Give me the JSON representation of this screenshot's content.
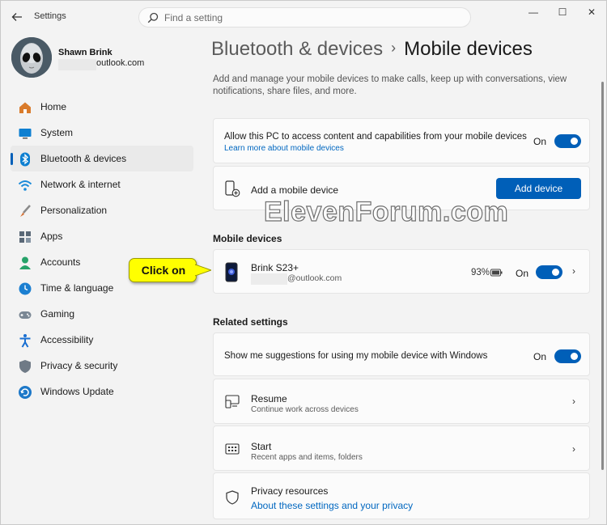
{
  "app": {
    "title": "Settings"
  },
  "search": {
    "placeholder": "Find a setting"
  },
  "window_controls": {
    "minimize": "—",
    "maximize": "☐",
    "close": "✕"
  },
  "profile": {
    "name": "Shawn Brink",
    "email_visible": "outlook.com"
  },
  "nav": {
    "items": [
      {
        "label": "Home",
        "icon": "home-icon",
        "color": "#d97b2b"
      },
      {
        "label": "System",
        "icon": "system-icon",
        "color": "#0d7fd1"
      },
      {
        "label": "Bluetooth & devices",
        "icon": "bluetooth-icon",
        "color": "#0d7fd1",
        "active": true
      },
      {
        "label": "Network & internet",
        "icon": "wifi-icon",
        "color": "#1a8ad9"
      },
      {
        "label": "Personalization",
        "icon": "brush-icon",
        "color": "#d47236"
      },
      {
        "label": "Apps",
        "icon": "apps-icon",
        "color": "#5a6877"
      },
      {
        "label": "Accounts",
        "icon": "accounts-icon",
        "color": "#26a269"
      },
      {
        "label": "Time & language",
        "icon": "globe-clock-icon",
        "color": "#1b7fd1"
      },
      {
        "label": "Gaming",
        "icon": "controller-icon",
        "color": "#7a8794"
      },
      {
        "label": "Accessibility",
        "icon": "accessibility-icon",
        "color": "#1a6fd1"
      },
      {
        "label": "Privacy & security",
        "icon": "shield-icon",
        "color": "#6f7a86"
      },
      {
        "label": "Windows Update",
        "icon": "update-icon",
        "color": "#1d78c8"
      }
    ]
  },
  "breadcrumb": {
    "parent": "Bluetooth & devices",
    "separator": "›",
    "current": "Mobile devices"
  },
  "description": "Add and manage your mobile devices to make calls, keep up with conversations, view notifications, share files, and more.",
  "access": {
    "label": "Allow this PC to access content and capabilities from your mobile devices",
    "link": "Learn more about mobile devices",
    "state": "On"
  },
  "add_device": {
    "label": "Add a mobile device",
    "button": "Add device"
  },
  "mobile_devices": {
    "title": "Mobile devices",
    "device": {
      "name": "Brink S23+",
      "email_visible": "@outlook.com",
      "battery": "93%",
      "state": "On"
    }
  },
  "related": {
    "title": "Related settings",
    "suggestions": {
      "label": "Show me suggestions for using my mobile device with Windows",
      "state": "On"
    },
    "resume": {
      "title": "Resume",
      "subtitle": "Continue work across devices"
    },
    "start": {
      "title": "Start",
      "subtitle": "Recent apps and items, folders"
    },
    "privacy": {
      "title": "Privacy resources",
      "link": "About these settings and your privacy"
    }
  },
  "watermark": "ElevenForum.com",
  "callout": "Click on",
  "accent_color": "#005fb8"
}
